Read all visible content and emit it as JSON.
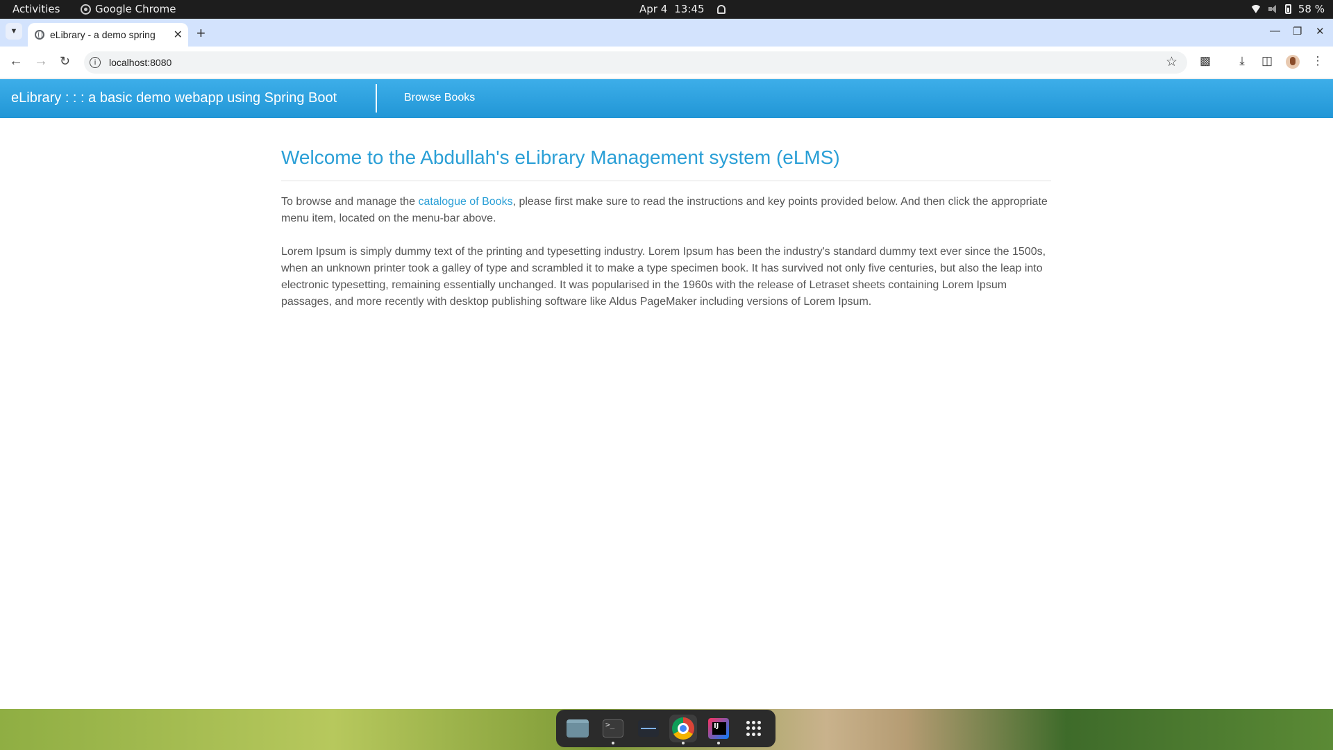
{
  "topbar": {
    "activities": "Activities",
    "app_name": "Google Chrome",
    "date": "Apr 4",
    "time": "13:45",
    "battery": "58 %"
  },
  "browser": {
    "tab_title": "eLibrary - a demo spring",
    "url": "localhost:8080"
  },
  "app": {
    "brand": "eLibrary : : : a basic demo webapp using Spring Boot",
    "nav_link": "Browse Books",
    "heading": "Welcome to the Abdullah's eLibrary Management system (eLMS)",
    "intro_before": "To browse and manage the ",
    "intro_link": "catalogue of Books",
    "intro_after": ", please first make sure to read the instructions and key points provided below. And then click the appropriate menu item, located on the menu-bar above.",
    "lorem": "Lorem Ipsum is simply dummy text of the printing and typesetting industry. Lorem Ipsum has been the industry's standard dummy text ever since the 1500s, when an unknown printer took a galley of type and scrambled it to make a type specimen book. It has survived not only five centuries, but also the leap into electronic typesetting, remaining essentially unchanged. It was popularised in the 1960s with the release of Letraset sheets containing Lorem Ipsum passages, and more recently with desktop publishing software like Aldus PageMaker including versions of Lorem Ipsum."
  },
  "dock": {
    "items": [
      "files-icon",
      "terminal-icon",
      "system-monitor-icon",
      "chrome-icon",
      "intellij-icon",
      "app-grid-icon"
    ]
  },
  "colors": {
    "nav_bar": "#2a9fd6",
    "heading": "#2a9fd6",
    "link": "#2a9fd6",
    "body_text": "#555555"
  }
}
